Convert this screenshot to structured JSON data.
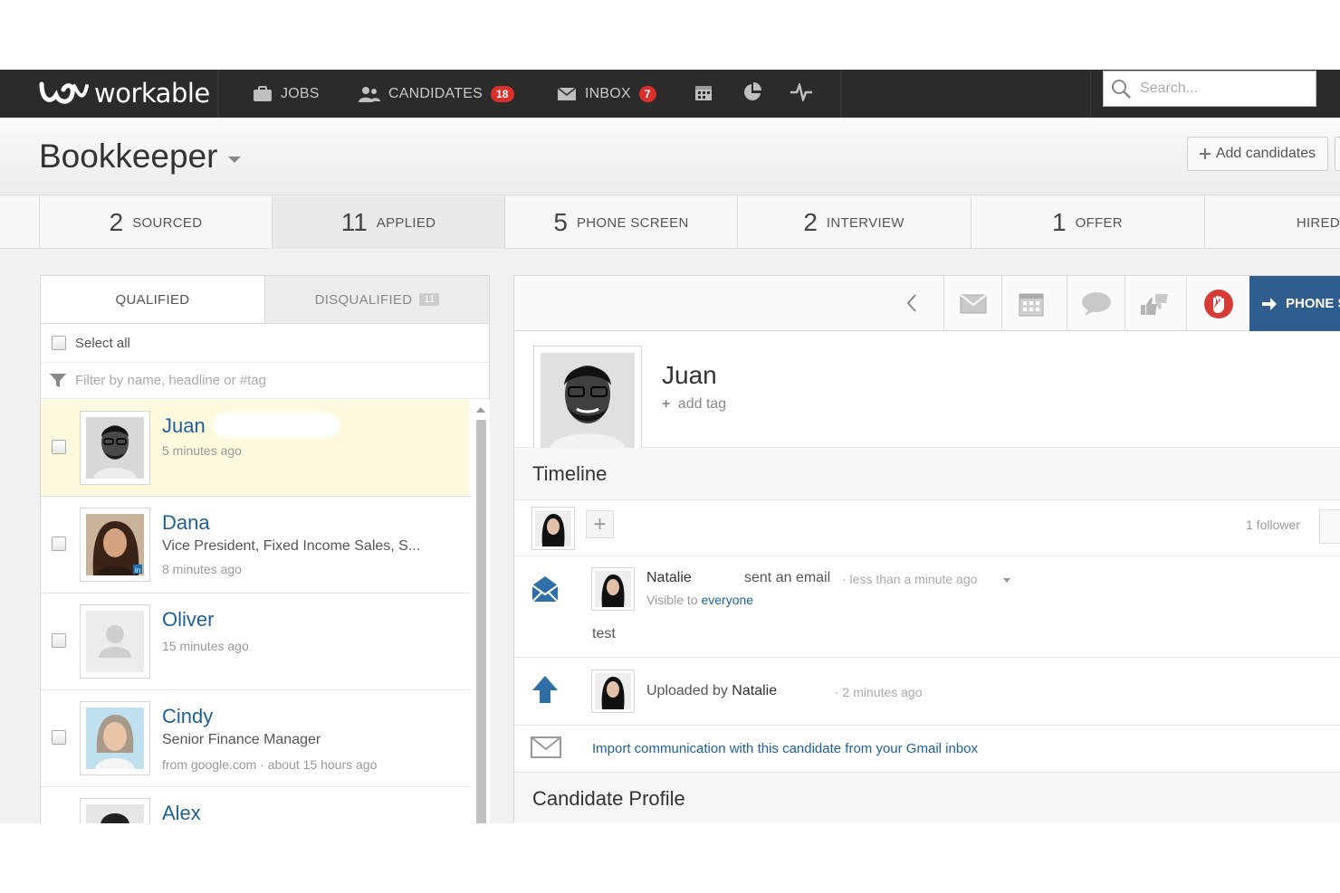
{
  "nav": {
    "logo": "workable",
    "jobs": "JOBS",
    "candidates": "CANDIDATES",
    "candidates_count": "18",
    "inbox": "INBOX",
    "inbox_count": "7",
    "search_placeholder": "Search..."
  },
  "job": {
    "title": "Bookkeeper",
    "add_candidates": "Add candidates"
  },
  "stages": [
    {
      "count": "2",
      "label": "SOURCED"
    },
    {
      "count": "11",
      "label": "APPLIED"
    },
    {
      "count": "5",
      "label": "PHONE SCREEN"
    },
    {
      "count": "2",
      "label": "INTERVIEW"
    },
    {
      "count": "1",
      "label": "OFFER"
    },
    {
      "count": "",
      "label": "HIRED"
    }
  ],
  "left": {
    "tab_qualified": "QUALIFIED",
    "tab_disqualified": "DISQUALIFIED",
    "disqualified_count": "11",
    "select_all": "Select all",
    "filter_placeholder": "Filter by name, headline or #tag",
    "candidates": [
      {
        "name": "Juan",
        "headline": "",
        "time": "5 minutes ago"
      },
      {
        "name": "Dana",
        "headline": "Vice President, Fixed Income Sales, S...",
        "time": "8 minutes ago"
      },
      {
        "name": "Oliver",
        "headline": "",
        "time": "15 minutes ago"
      },
      {
        "name": "Cindy",
        "headline": "Senior Finance Manager",
        "time": "from google.com · about 15 hours ago"
      },
      {
        "name": "Alex",
        "headline": "",
        "time": ""
      }
    ]
  },
  "right": {
    "phone_button": "PHONE S",
    "candidate_name": "Juan",
    "add_tag": "add tag",
    "timeline_title": "Timeline",
    "followers": "1 follower",
    "event1": {
      "author": "Natalie",
      "action": "sent an email",
      "time": "· less than a minute ago",
      "visible_prefix": "Visible to",
      "visible_link": "everyone",
      "body": "test"
    },
    "event2": {
      "prefix": "Uploaded by",
      "author": "Natalie",
      "time": "· 2 minutes ago"
    },
    "import_link": "Import communication with this candidate from your Gmail inbox",
    "profile_title": "Candidate Profile"
  }
}
